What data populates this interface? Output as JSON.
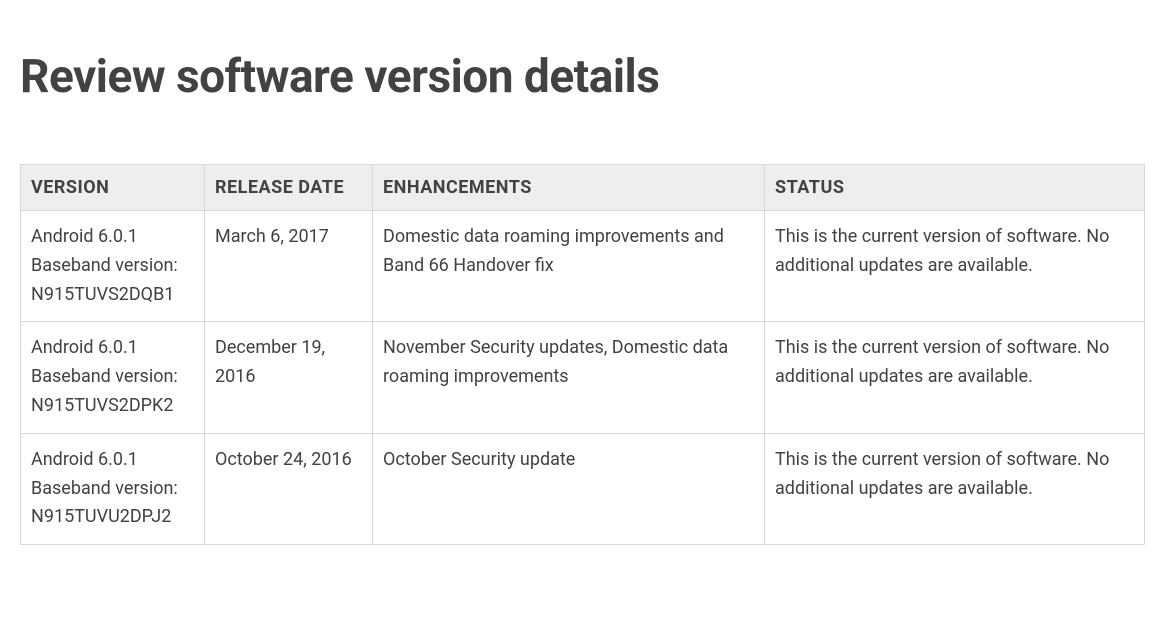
{
  "heading": "Review software version details",
  "table": {
    "headers": {
      "version": "VERSION",
      "release_date": "RELEASE DATE",
      "enhancements": "ENHANCEMENTS",
      "status": "STATUS"
    },
    "rows": [
      {
        "version": "Android 6.0.1 Baseband version: N915TUVS2DQB1",
        "release_date": "March 6, 2017",
        "enhancements": "Domestic data roaming improvements and Band 66 Handover fix",
        "status": "This is the current version of software. No additional updates are available."
      },
      {
        "version": "Android 6.0.1 Baseband version: N915TUVS2DPK2",
        "release_date": "December 19, 2016",
        "enhancements": "November Security updates, Domestic data roaming improvements",
        "status": "This is the current version of software. No additional updates are available."
      },
      {
        "version": "Android 6.0.1 Baseband version: N915TUVU2DPJ2",
        "release_date": "October 24, 2016",
        "enhancements": "October Security update",
        "status": "This is the current version of software. No additional updates are available."
      }
    ]
  }
}
